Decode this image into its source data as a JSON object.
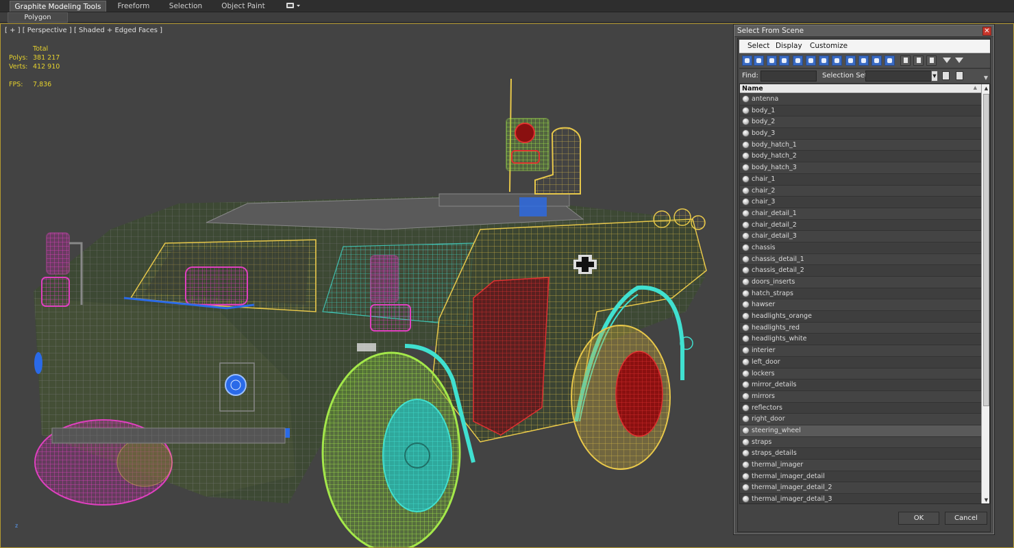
{
  "ribbon": {
    "tabs": [
      "Graphite Modeling Tools",
      "Freeform",
      "Selection",
      "Object Paint"
    ],
    "sub_label": "Polygon Modeling"
  },
  "viewport": {
    "label": "[ + ] [ Perspective ] [ Shaded + Edged Faces ]",
    "stats": {
      "total_label": "Total",
      "polys_label": "Polys:",
      "polys_value": "381 217",
      "verts_label": "Verts:",
      "verts_value": "412 910",
      "fps_label": "FPS:",
      "fps_value": "7,836"
    },
    "axis_label": "z"
  },
  "dialog": {
    "title": "Select From Scene",
    "menus": [
      "Select",
      "Display",
      "Customize"
    ],
    "find_label": "Find:",
    "find_value": "",
    "selection_set_label": "Selection Set:",
    "list_header": "Name",
    "items": [
      "antenna",
      "body_1",
      "body_2",
      "body_3",
      "body_hatch_1",
      "body_hatch_2",
      "body_hatch_3",
      "chair_1",
      "chair_2",
      "chair_3",
      "chair_detail_1",
      "chair_detail_2",
      "chair_detail_3",
      "chassis",
      "chassis_detail_1",
      "chassis_detail_2",
      "doors_inserts",
      "hatch_straps",
      "hawser",
      "headlights_orange",
      "headlights_red",
      "headlights_white",
      "interier",
      "left_door",
      "lockers",
      "mirror_details",
      "mirrors",
      "reflectors",
      "right_door",
      "steering_wheel",
      "straps",
      "straps_details",
      "thermal_imager",
      "thermal_imager_detail",
      "thermal_imager_detail_2",
      "thermal_imager_detail_3"
    ],
    "highlighted_item": "steering_wheel",
    "ok_label": "OK",
    "cancel_label": "Cancel"
  },
  "colors": {
    "wire_yellow": "#e8c84a",
    "wire_green": "#a4e84a",
    "wire_cyan": "#40e0d0",
    "wire_magenta": "#e040c0",
    "wire_red": "#cc2020",
    "wire_blue": "#2a6ae8",
    "viewport_border": "#b59a30",
    "stats_text": "#e6d22d"
  }
}
